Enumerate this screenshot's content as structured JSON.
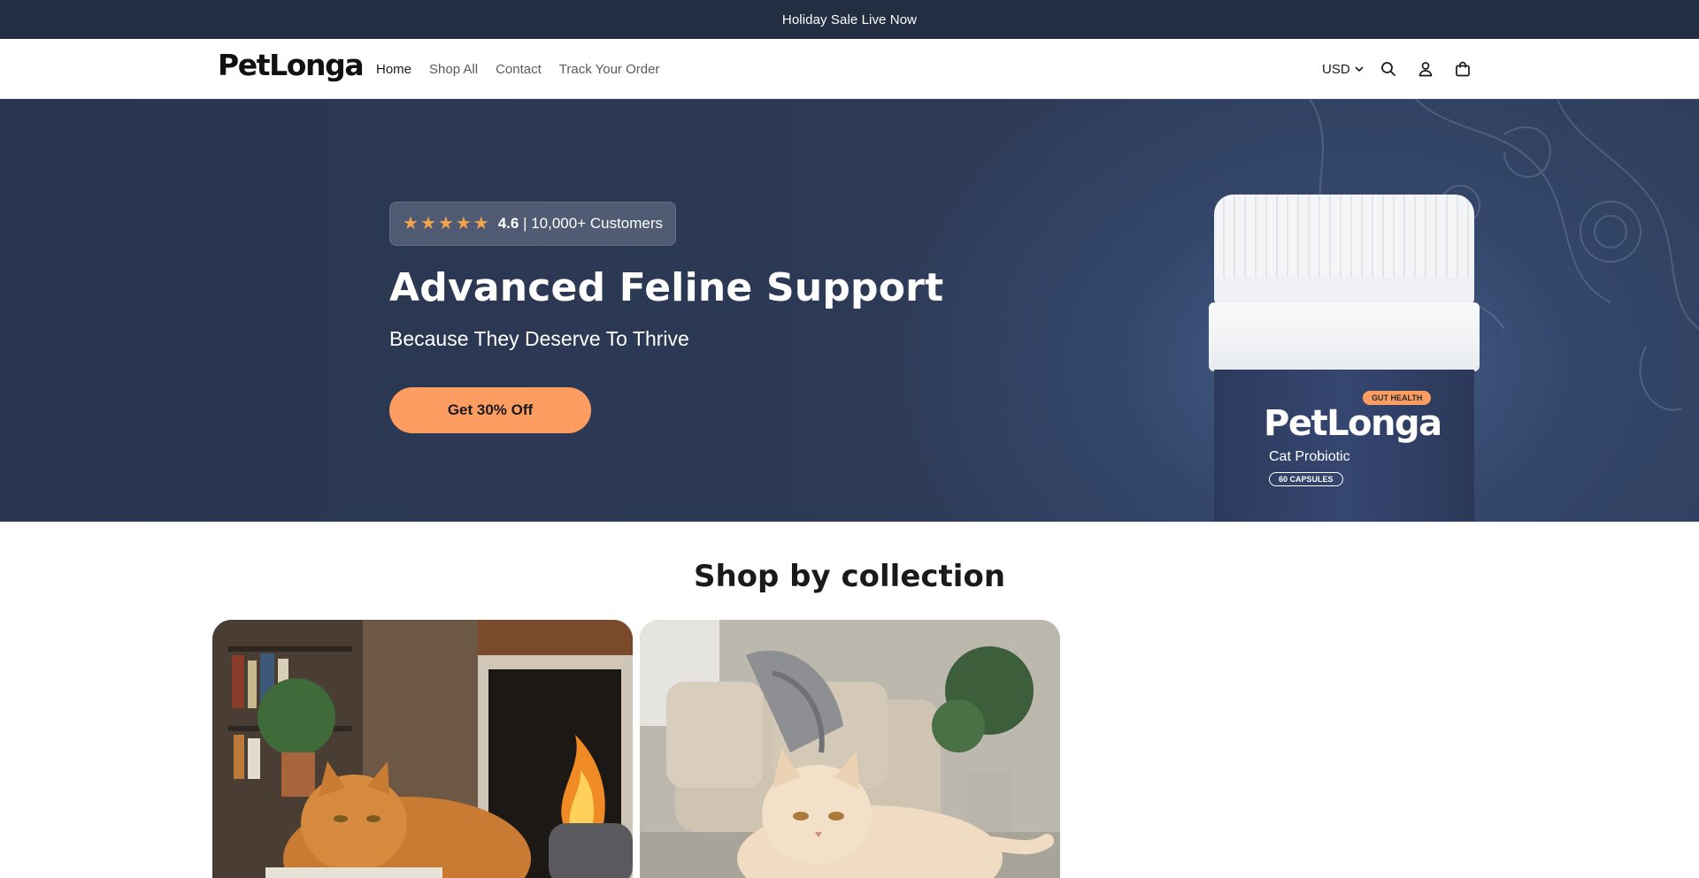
{
  "announcement": {
    "text": "Holiday Sale Live Now"
  },
  "header": {
    "logo": "PetLonga",
    "nav": [
      {
        "label": "Home",
        "active": true
      },
      {
        "label": "Shop All",
        "active": false
      },
      {
        "label": "Contact",
        "active": false
      },
      {
        "label": "Track Your Order",
        "active": false
      }
    ],
    "currency": "USD",
    "icons": [
      "search-icon",
      "account-icon",
      "cart-icon"
    ]
  },
  "hero": {
    "stars": 5,
    "rating_value": "4.6",
    "rating_customers": "| 10,000+ Customers",
    "title": "Advanced Feline Support",
    "subtitle": "Because They Deserve To Thrive",
    "cta": "Get 30% Off",
    "product": {
      "tag": "GUT HEALTH",
      "brand": "PetLonga",
      "name": "Cat Probiotic",
      "capsules": "60 CAPSULES"
    }
  },
  "collections": {
    "title": "Shop by collection",
    "cards": [
      {
        "image": "orange cat resting by fireplace"
      },
      {
        "image": "cream cat in living room"
      }
    ]
  },
  "colors": {
    "announcement_bg": "#232e43",
    "hero_bg": "#2d3a56",
    "accent": "#fe9d62",
    "star": "#f2a24f"
  }
}
